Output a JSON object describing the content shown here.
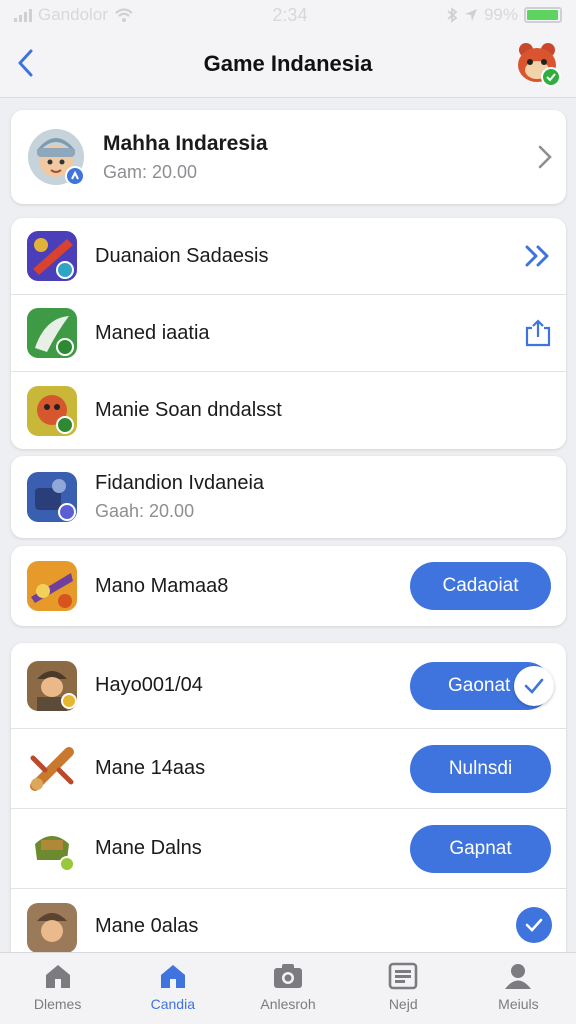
{
  "status_bar": {
    "carrier": "Gandolor",
    "time": "2:34",
    "battery_text": "99%"
  },
  "header": {
    "title": "Game Indanesia",
    "back_icon": "chevron-left-icon"
  },
  "profile": {
    "name": "Mahha Indaresia",
    "subtitle": "Gam: 20.00"
  },
  "list1": [
    {
      "title": "Duanaion Sadaesis",
      "trailing": "double-chevron-right-icon"
    },
    {
      "title": "Maned iaatia",
      "trailing": "share-icon"
    },
    {
      "title": "Manie Soan dndalsst",
      "trailing": ""
    }
  ],
  "card3": {
    "title": "Fidandion Ivdaneia",
    "subtitle": "Gaah: 20.00"
  },
  "card4": {
    "title": "Mano Mamaa8",
    "button": "Cadaoiat"
  },
  "list5": [
    {
      "title": "Hayo001/04",
      "button": "Gaonat",
      "checked": true
    },
    {
      "title": "Mane 14aas",
      "button": "Nulnsdi",
      "checked": false
    },
    {
      "title": "Mane Dalns",
      "button": "Gapnat",
      "checked": false
    },
    {
      "title": "Mane 0alas",
      "button": "",
      "checked": true
    }
  ],
  "tabs": [
    {
      "label": "Dlemes",
      "icon": "home-icon",
      "active": false
    },
    {
      "label": "Candia",
      "icon": "home-icon",
      "active": true
    },
    {
      "label": "Anlesroh",
      "icon": "camera-icon",
      "active": false
    },
    {
      "label": "Nejd",
      "icon": "news-icon",
      "active": false
    },
    {
      "label": "Meiuls",
      "icon": "profile-icon",
      "active": false
    }
  ],
  "colors": {
    "accent": "#3f74de",
    "background": "#eeeff2",
    "card": "#ffffff",
    "muted": "#8e8e93"
  }
}
